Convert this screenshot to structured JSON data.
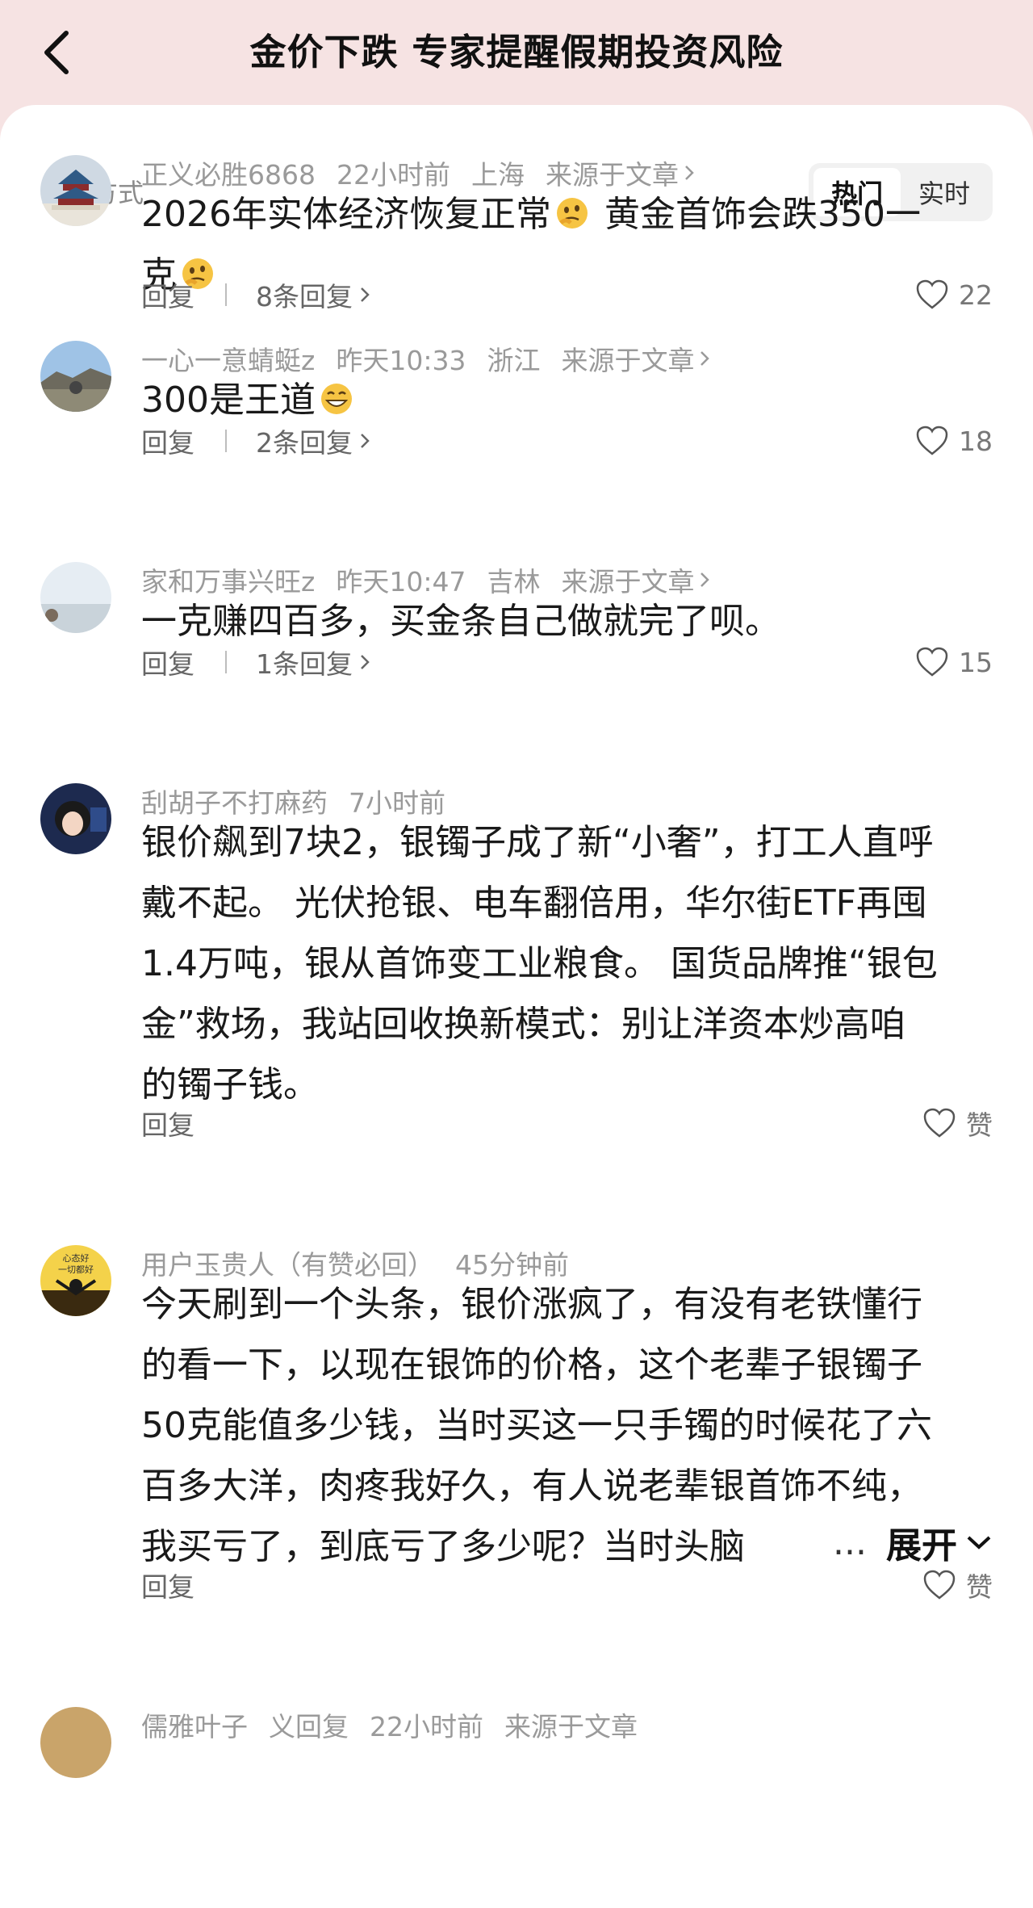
{
  "header": {
    "title": "金价下跌 专家提醒假期投资风险"
  },
  "sort": {
    "label": "排序方式",
    "options": [
      "热门",
      "实时"
    ],
    "active": "热门"
  },
  "reply_label": "回复",
  "comments": [
    {
      "user": "正义必胜6868",
      "time": "22小时前",
      "location": "上海",
      "source": "来源于文章",
      "text_1": "2026年实体经济恢复正常",
      "text_2": " 黄金首饰会跌350一",
      "text_3": "克",
      "replies": "8条回复",
      "likes": "22",
      "avatar_icon": "temple-avatar"
    },
    {
      "user": "一心一意蜻蜓z",
      "time": "昨天10:33",
      "location": "浙江",
      "source": "来源于文章",
      "text": "300是王道",
      "replies": "2条回复",
      "likes": "18",
      "avatar_icon": "landscape-avatar"
    },
    {
      "user": "家和万事兴旺z",
      "time": "昨天10:47",
      "location": "吉林",
      "source": "来源于文章",
      "text": "一克赚四百多，买金条自己做就完了呗。",
      "replies": "1条回复",
      "likes": "15",
      "avatar_icon": "sky-avatar"
    },
    {
      "user": "刮胡子不打麻药",
      "time": "7小时前",
      "text": "银价飙到7块2，银镯子成了新“小奢”，打工人直呼\n戴不起。 光伏抢银、电车翻倍用，华尔街ETF再囤\n1.4万吨，银从首饰变工业粮食。 国货品牌推“银包\n金”救场，我站回收换新模式：别让洋资本炒高咱\n的镯子钱。",
      "likes": "赞",
      "avatar_icon": "cartoon-avatar"
    },
    {
      "user": "用户玉贵人（有赞必回）",
      "time": "45分钟前",
      "text": "今天刷到一个头条，银价涨疯了，有没有老铁懂行\n的看一下，以现在银饰的价格，这个老辈子银镯子\n50克能值多少钱，当时买这一只手镯的时候花了六\n百多大洋，肉疼我好久，有人说老辈银首饰不纯，\n我买亏了，到底亏了多少呢？当时头脑",
      "expand": "展开",
      "ellipsis": "...",
      "likes": "赞",
      "avatar_icon": "sunset-avatar",
      "avatar_text": "心态好\n一切都好"
    },
    {
      "user": "儒雅叶子",
      "time": "22小时前",
      "location": "",
      "source": "来源于文章",
      "partial": "义回复"
    }
  ],
  "colors": {
    "header_bg": "#f6e3e3",
    "meta": "#9a9a9a",
    "text": "#1a1a1a"
  }
}
